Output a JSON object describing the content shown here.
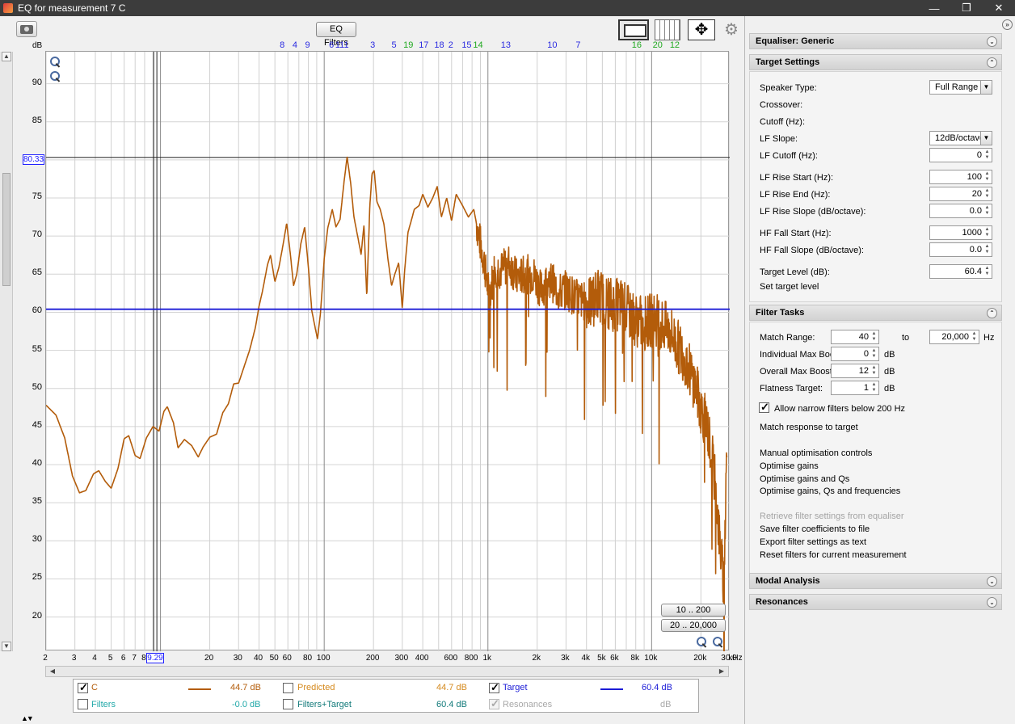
{
  "window": {
    "title": "EQ for measurement 7 C",
    "minimize": "—",
    "restore": "❐",
    "close": "✕"
  },
  "toolbar": {
    "eq_filters": "EQ Filters"
  },
  "graph": {
    "y_unit": "dB",
    "x_unit": "kHz",
    "y_ticks": [
      "90",
      "85",
      "80",
      "75",
      "70",
      "65",
      "60",
      "55",
      "50",
      "45",
      "40",
      "35",
      "30",
      "25",
      "20"
    ],
    "x_ticks": [
      {
        "f": 2,
        "label": "2"
      },
      {
        "f": 3,
        "label": "3"
      },
      {
        "f": 4,
        "label": "4"
      },
      {
        "f": 5,
        "label": "5"
      },
      {
        "f": 6,
        "label": "6"
      },
      {
        "f": 7,
        "label": "7"
      },
      {
        "f": 8,
        "label": "8"
      },
      {
        "f": 20,
        "label": "20"
      },
      {
        "f": 30,
        "label": "30"
      },
      {
        "f": 40,
        "label": "40"
      },
      {
        "f": 50,
        "label": "50"
      },
      {
        "f": 60,
        "label": "60"
      },
      {
        "f": 80,
        "label": "80"
      },
      {
        "f": 100,
        "label": "100"
      },
      {
        "f": 200,
        "label": "200"
      },
      {
        "f": 300,
        "label": "300"
      },
      {
        "f": 400,
        "label": "400"
      },
      {
        "f": 600,
        "label": "600"
      },
      {
        "f": 800,
        "label": "800"
      },
      {
        "f": 1000,
        "label": "1k"
      },
      {
        "f": 2000,
        "label": "2k"
      },
      {
        "f": 3000,
        "label": "3k"
      },
      {
        "f": 4000,
        "label": "4k"
      },
      {
        "f": 5000,
        "label": "5k"
      },
      {
        "f": 6000,
        "label": "6k"
      },
      {
        "f": 8000,
        "label": "8k"
      },
      {
        "f": 10000,
        "label": "10k"
      },
      {
        "f": 20000,
        "label": "20k"
      },
      {
        "f": 30000,
        "label": "30.0"
      }
    ],
    "cursor_db": "80.33",
    "cursor_freq": "9.29",
    "filter_markers": [
      {
        "f": 56,
        "label": "8",
        "color": "#2a2ae0"
      },
      {
        "f": 67,
        "label": "4",
        "color": "#2a2ae0"
      },
      {
        "f": 80,
        "label": "9",
        "color": "#2a2ae0"
      },
      {
        "f": 112,
        "label": "6",
        "color": "#2a2ae0"
      },
      {
        "f": 130,
        "label": "111",
        "color": "#2a2ae0"
      },
      {
        "f": 200,
        "label": "3",
        "color": "#2a2ae0"
      },
      {
        "f": 270,
        "label": "5",
        "color": "#2a2ae0"
      },
      {
        "f": 330,
        "label": "19",
        "color": "#1fa81f"
      },
      {
        "f": 410,
        "label": "17",
        "color": "#2a2ae0"
      },
      {
        "f": 510,
        "label": "18",
        "color": "#2a2ae0"
      },
      {
        "f": 600,
        "label": "2",
        "color": "#2a2ae0"
      },
      {
        "f": 750,
        "label": "15",
        "color": "#2a2ae0"
      },
      {
        "f": 880,
        "label": "14",
        "color": "#1fa81f"
      },
      {
        "f": 1300,
        "label": "13",
        "color": "#2a2ae0"
      },
      {
        "f": 2500,
        "label": "10",
        "color": "#2a2ae0"
      },
      {
        "f": 3600,
        "label": "7",
        "color": "#2a2ae0"
      },
      {
        "f": 8200,
        "label": "16",
        "color": "#1fa81f"
      },
      {
        "f": 11000,
        "label": "20",
        "color": "#1fa81f"
      },
      {
        "f": 14000,
        "label": "12",
        "color": "#1fa81f"
      }
    ],
    "target_level_db": 60.4,
    "range_buttons": [
      "10 .. 200",
      "20 .. 20,000"
    ]
  },
  "legend": {
    "c": {
      "label": "C",
      "value": "44.7 dB",
      "checked": true,
      "color": "#b35c0a"
    },
    "predicted": {
      "label": "Predicted",
      "value": "44.7 dB",
      "checked": false,
      "color": "#d58a1e"
    },
    "target": {
      "label": "Target",
      "value": "60.4 dB",
      "checked": true,
      "color": "#1b1bd6"
    },
    "filters": {
      "label": "Filters",
      "value": "-0.0 dB",
      "checked": false,
      "color": "#20a8a8"
    },
    "filters_target": {
      "label": "Filters+Target",
      "value": "60.4 dB",
      "checked": false,
      "color": "#127a7a"
    },
    "resonances": {
      "label": "Resonances",
      "value": "dB",
      "checked": true,
      "color": "#a8a8a8"
    }
  },
  "sidebar": {
    "equaliser": {
      "title": "Equaliser: Generic"
    },
    "target_settings": {
      "title": "Target Settings",
      "speaker_type": {
        "label": "Speaker Type:",
        "value": "Full Range"
      },
      "crossover": {
        "label": "Crossover:"
      },
      "cutoff": {
        "label": "Cutoff (Hz):"
      },
      "lf_slope": {
        "label": "LF Slope:",
        "value": "12dB/octave"
      },
      "lf_cutoff": {
        "label": "LF Cutoff (Hz):",
        "value": "0"
      },
      "lf_rise_start": {
        "label": "LF Rise Start (Hz):",
        "value": "100"
      },
      "lf_rise_end": {
        "label": "LF Rise End (Hz):",
        "value": "20"
      },
      "lf_rise_slope": {
        "label": "LF Rise Slope (dB/octave):",
        "value": "0.0"
      },
      "hf_fall_start": {
        "label": "HF Fall Start (Hz):",
        "value": "1000"
      },
      "hf_fall_slope": {
        "label": "HF Fall Slope (dB/octave):",
        "value": "0.0"
      },
      "target_level": {
        "label": "Target Level (dB):",
        "value": "60.4"
      },
      "set_target": "Set target level"
    },
    "filter_tasks": {
      "title": "Filter Tasks",
      "match_range": {
        "label": "Match Range:",
        "from": "40",
        "to_label": "to",
        "to": "20,000",
        "unit": "Hz"
      },
      "individual_max_boost": {
        "label": "Individual Max Boost:",
        "value": "0",
        "unit": "dB"
      },
      "overall_max_boost": {
        "label": "Overall Max Boost:",
        "value": "12",
        "unit": "dB"
      },
      "flatness_target": {
        "label": "Flatness Target:",
        "value": "1",
        "unit": "dB"
      },
      "allow_narrow": {
        "label": "Allow narrow filters below 200 Hz",
        "checked": true
      },
      "match_response": "Match response to target",
      "manual_opt": "Manual optimisation controls",
      "opt_gains": "Optimise gains",
      "opt_gains_qs": "Optimise gains and Qs",
      "opt_gains_qs_freqs": "Optimise gains, Qs and frequencies",
      "retrieve": "Retrieve filter settings from equaliser",
      "save_coeffs": "Save filter coefficients to file",
      "export_text": "Export filter settings as text",
      "reset_filters": "Reset filters for current measurement"
    },
    "modal_analysis": {
      "title": "Modal Analysis"
    },
    "resonances": {
      "title": "Resonances"
    }
  }
}
